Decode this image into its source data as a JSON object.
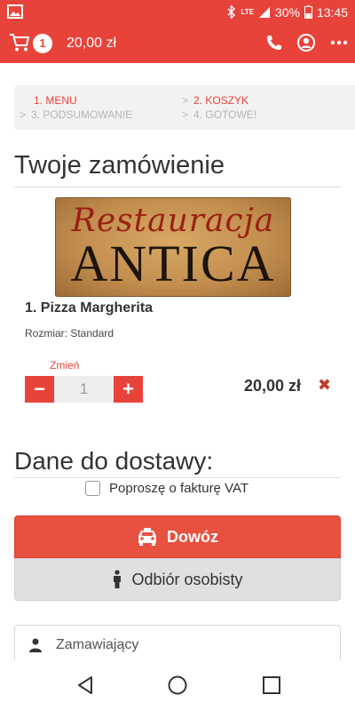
{
  "statusbar": {
    "battery": "30%",
    "time": "13:45",
    "network": "LTE"
  },
  "appbar": {
    "cart_count": "1",
    "cart_total": "20,00 zł"
  },
  "steps": [
    {
      "label": "1. MENU"
    },
    {
      "label": "2. KOSZYK"
    },
    {
      "label": "3. PODSUMOWANIE"
    },
    {
      "label": "4. GOTOWE!"
    }
  ],
  "order": {
    "title": "Twoje zamówienie",
    "logo_line1": "Restauracja",
    "logo_line2": "ANTICA",
    "item_name": "1. Pizza Margherita",
    "item_size": "Rozmiar: Standard",
    "change_label": "Zmień",
    "quantity": "1",
    "minus": "−",
    "plus": "+",
    "price": "20,00 zł",
    "remove": "✖"
  },
  "delivery": {
    "title": "Dane do dostawy:",
    "vat_label": "Poproszę o fakturę VAT",
    "delivery_btn": "Dowóz",
    "pickup_btn": "Odbiór osobisty",
    "orderer_placeholder": "Zamawiający"
  },
  "colors": {
    "accent": "#e8433a",
    "secondary_btn": "#e0e0e0"
  }
}
